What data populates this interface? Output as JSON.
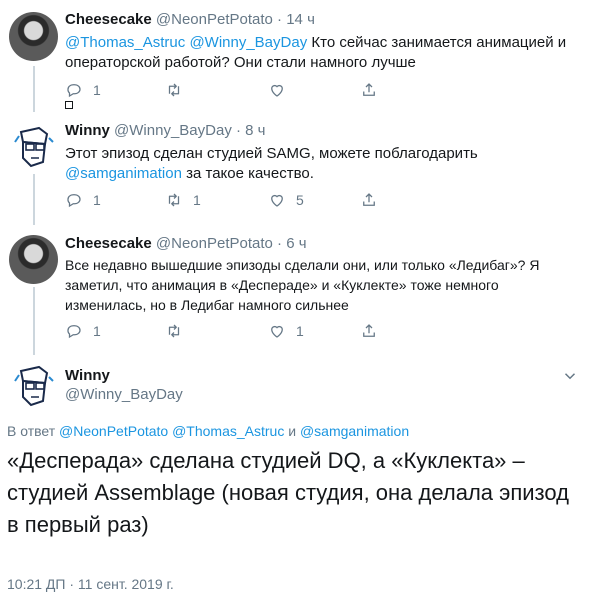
{
  "tweets": [
    {
      "name": "Cheesecake",
      "handle": "@NeonPetPotato",
      "sep": "·",
      "time": "14 ч",
      "mention1": "@Thomas_Astruc",
      "mention2": "@Winny_BayDay",
      "text_rest": " Кто сейчас занимается анимацией и операторской работой? Они стали намного лучше",
      "reply_count": "1",
      "retweet_count": "",
      "like_count": ""
    },
    {
      "name": "Winny",
      "handle": "@Winny_BayDay",
      "sep": "·",
      "time": "8 ч",
      "text_before": "Этот эпизод сделан студией SAMG, можете поблагодарить ",
      "mention": "@samganimation",
      "text_after": " за такое качество.",
      "reply_count": "1",
      "retweet_count": "1",
      "like_count": "5"
    },
    {
      "name": "Cheesecake",
      "handle": "@NeonPetPotato",
      "sep": "·",
      "time": "6 ч",
      "text": "Все недавно вышедшие эпизоды сделали они, или только «Ледибаг»? Я заметил, что анимация в «Десперадe» и «Куклекте» тоже немного изменилась, но в Ледибаг намного сильнее",
      "reply_count": "1",
      "retweet_count": "",
      "like_count": "1"
    }
  ],
  "main_tweet": {
    "name": "Winny",
    "handle": "@Winny_BayDay",
    "reply_prefix": "В ответ ",
    "reply_m1": "@NeonPetPotato",
    "reply_m2": "@Thomas_Astruc",
    "reply_and": " и ",
    "reply_m3": "@samganimation",
    "text": "«Десперада» сделана студией DQ, а «Куклекта» – студией Assemblage (новая студия, она делала эпизод в первый раз)",
    "timestamp": "10:21 ДП · 11 сент. 2019 г."
  },
  "icons": [
    "reply-icon",
    "retweet-icon",
    "like-icon",
    "share-icon",
    "chevron-down-icon"
  ],
  "colors": {
    "link": "#1b95e0",
    "muted": "#657786",
    "text": "#14171a"
  }
}
